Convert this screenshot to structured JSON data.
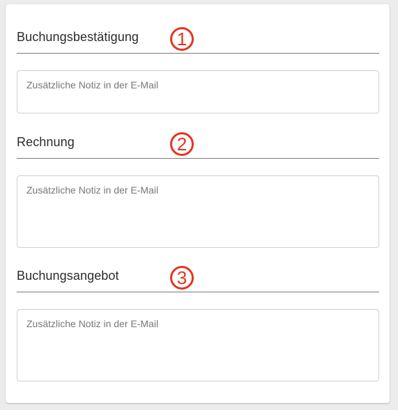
{
  "sections": [
    {
      "title": "Buchungsbestätigung",
      "badge": "1",
      "note": {
        "value": "",
        "placeholder": "Zusätzliche Notiz in der E-Mail"
      }
    },
    {
      "title": "Rechnung",
      "badge": "2",
      "note": {
        "value": "",
        "placeholder": "Zusätzliche Notiz in der E-Mail"
      }
    },
    {
      "title": "Buchungsangebot",
      "badge": "3",
      "note": {
        "value": "",
        "placeholder": "Zusätzliche Notiz in der E-Mail"
      }
    }
  ],
  "colors": {
    "badge": "#e5341f",
    "divider": "#7a7a7a",
    "field_border": "#cfcfcf"
  }
}
